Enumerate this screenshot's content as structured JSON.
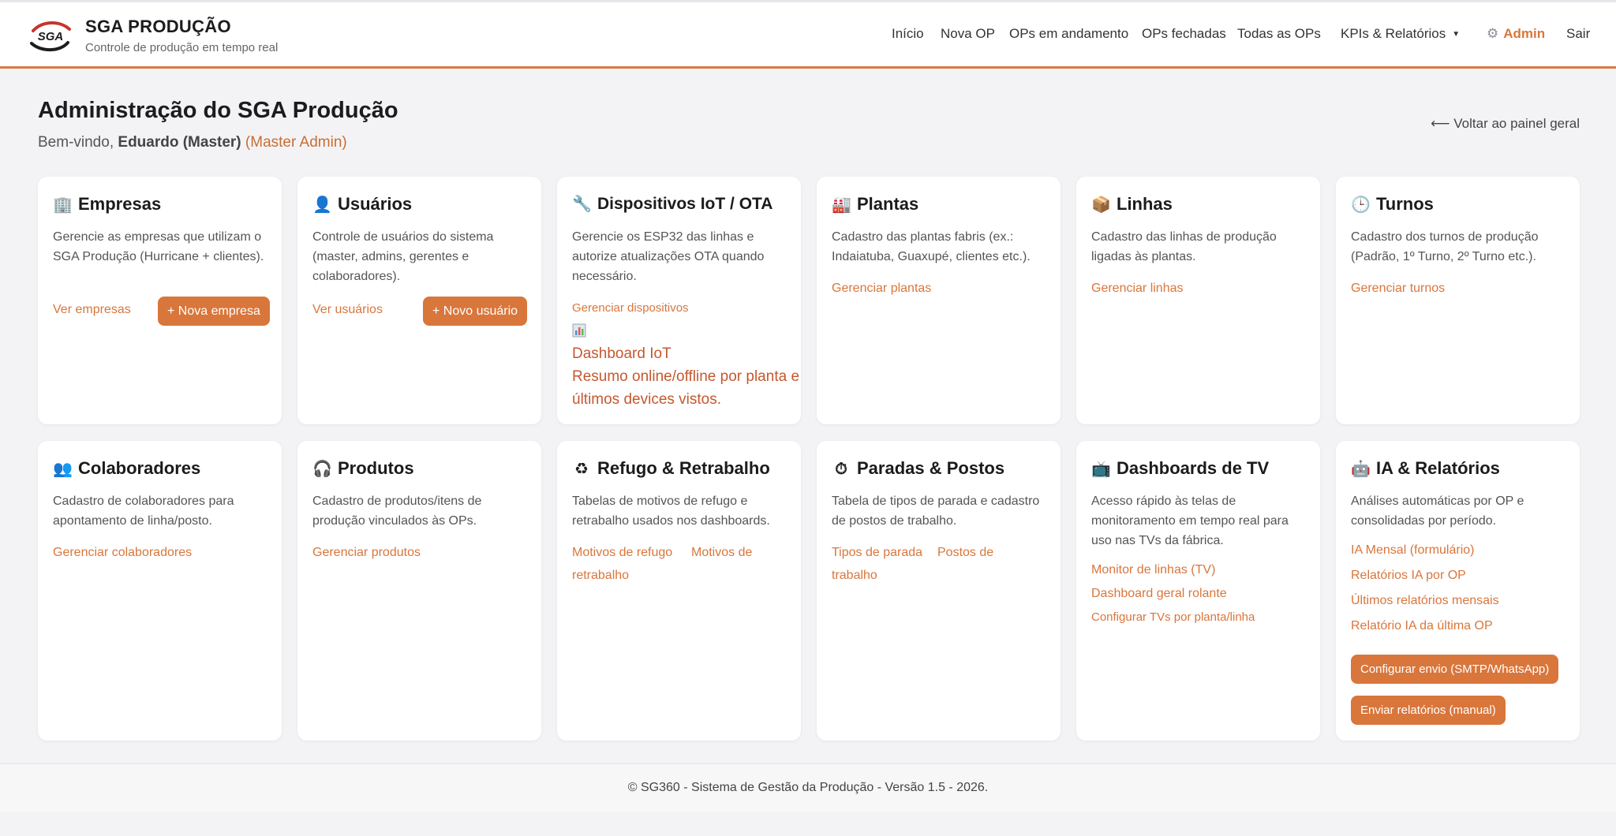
{
  "header": {
    "brand_title": "SGA PRODUÇÃO",
    "brand_subtitle": "Controle de produção em tempo real",
    "logo_text": "SGA",
    "nav": {
      "inicio": "Início",
      "nova_op": "Nova OP",
      "ops_andamento": "OPs em andamento",
      "ops_fechadas": "OPs fechadas",
      "todas_ops": "Todas as OPs",
      "kpis": "KPIs & Relatórios",
      "admin": "Admin",
      "sair": "Sair"
    }
  },
  "page": {
    "title": "Administração do SGA Produção",
    "welcome_prefix": "Bem-vindo,",
    "user_name": "Eduardo (Master)",
    "user_role": "(Master Admin)",
    "back_link": "⟵ Voltar ao painel geral"
  },
  "cards": {
    "empresas": {
      "icon": "building-icon",
      "title": "Empresas",
      "desc": "Gerencie as empresas que utilizam o SGA Produção (Hurricane + clientes).",
      "link": "Ver empresas",
      "button": "+ Nova empresa"
    },
    "usuarios": {
      "icon": "user-icon",
      "title": "Usuários",
      "desc": "Controle de usuários do sistema (master, admins, gerentes e colaboradores).",
      "link": "Ver usuários",
      "button": "+ Novo usuário"
    },
    "dispositivos": {
      "icon": "wrench-icon",
      "title": "Dispositivos IoT / OTA",
      "desc": "Gerencie os ESP32 das linhas e autorize atualizações OTA quando necessário.",
      "link": "Gerenciar dispositivos",
      "dashboard_title": "Dashboard IoT",
      "dashboard_desc": "Resumo online/offline por planta e últimos devices vistos."
    },
    "plantas": {
      "icon": "factory-icon",
      "title": "Plantas",
      "desc": "Cadastro das plantas fabris (ex.: Indaiatuba, Guaxupé, clientes etc.).",
      "link": "Gerenciar plantas"
    },
    "linhas": {
      "icon": "package-icon",
      "title": "Linhas",
      "desc": "Cadastro das linhas de produção ligadas às plantas.",
      "link": "Gerenciar linhas"
    },
    "turnos": {
      "icon": "clock-icon",
      "title": "Turnos",
      "desc": "Cadastro dos turnos de produção (Padrão, 1º Turno, 2º Turno etc.).",
      "link": "Gerenciar turnos"
    },
    "colaboradores": {
      "icon": "people-icon",
      "title": "Colaboradores",
      "desc": "Cadastro de colaboradores para apontamento de linha/posto.",
      "link": "Gerenciar colaboradores"
    },
    "produtos": {
      "icon": "headphones-icon",
      "title": "Produtos",
      "desc": "Cadastro de produtos/itens de produção vinculados às OPs.",
      "link": "Gerenciar produtos"
    },
    "refugo": {
      "icon": "recycle-icon",
      "title": "Refugo & Retrabalho",
      "desc": "Tabelas de motivos de refugo e retrabalho usados nos dashboards.",
      "link1": "Motivos de refugo",
      "link2_a": "Motivos de",
      "link2_b": "retrabalho"
    },
    "paradas": {
      "icon": "stopwatch-icon",
      "title": "Paradas & Postos",
      "desc": "Tabela de tipos de parada e cadastro de postos de trabalho.",
      "link1": "Tipos de parada",
      "link2_a": "Postos de",
      "link2_b": "trabalho"
    },
    "tv": {
      "icon": "tv-icon",
      "title": "Dashboards de TV",
      "desc": "Acesso rápido às telas de monitoramento em tempo real para uso nas TVs da fábrica.",
      "link1": "Monitor de linhas (TV)",
      "link2": "Dashboard geral rolante",
      "link3": "Configurar TVs por planta/linha"
    },
    "ia": {
      "icon": "robot-icon",
      "title": "IA & Relatórios",
      "desc": "Análises automáticas por OP e consolidadas por período.",
      "link1": "IA Mensal (formulário)",
      "link2": "Relatórios IA por OP",
      "link3": "Últimos relatórios mensais",
      "link4": "Relatório IA da última OP",
      "button1": "Configurar envio (SMTP/WhatsApp)",
      "button2": "Enviar relatórios (manual)"
    }
  },
  "footer": {
    "text": "© SG360 - Sistema de Gestão da Produção - Versão 1.5 - 2026."
  },
  "colors": {
    "accent": "#d9763b",
    "background": "#f3f3f5",
    "card": "#ffffff"
  }
}
